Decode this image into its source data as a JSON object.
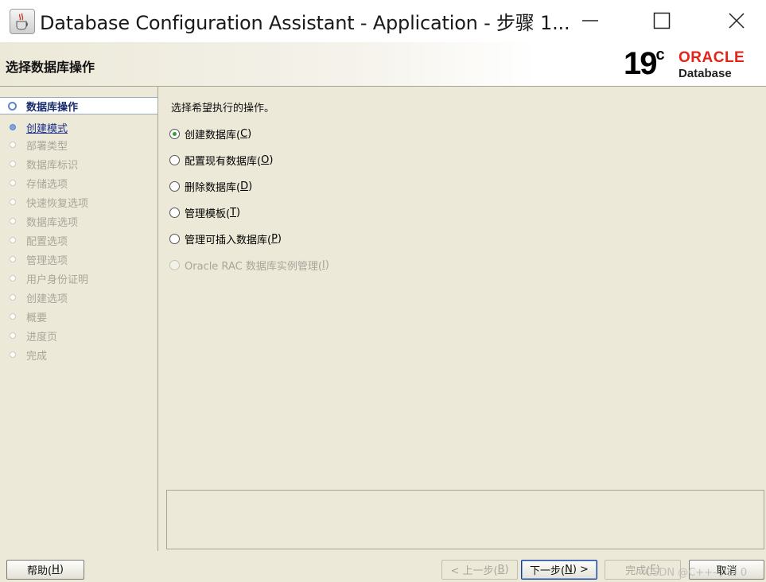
{
  "window": {
    "title": "Database Configuration Assistant - Application - 步骤 1...",
    "icon": "java-cup-icon"
  },
  "header": {
    "title": "选择数据库操作",
    "logo_version": "19",
    "logo_version_sup": "c",
    "logo_brand": "ORACLE",
    "logo_product": "Database",
    "brand_color": "#e3241b"
  },
  "steps": [
    {
      "label": "数据库操作",
      "state": "active"
    },
    {
      "label": "创建模式",
      "state": "link"
    },
    {
      "label": "部署类型",
      "state": "disabled"
    },
    {
      "label": "数据库标识",
      "state": "disabled"
    },
    {
      "label": "存储选项",
      "state": "disabled"
    },
    {
      "label": "快速恢复选项",
      "state": "disabled"
    },
    {
      "label": "数据库选项",
      "state": "disabled"
    },
    {
      "label": "配置选项",
      "state": "disabled"
    },
    {
      "label": "管理选项",
      "state": "disabled"
    },
    {
      "label": "用户身份证明",
      "state": "disabled"
    },
    {
      "label": "创建选项",
      "state": "disabled"
    },
    {
      "label": "概要",
      "state": "disabled"
    },
    {
      "label": "进度页",
      "state": "disabled"
    },
    {
      "label": "完成",
      "state": "disabled"
    }
  ],
  "main": {
    "prompt": "选择希望执行的操作。",
    "options": [
      {
        "label": "创建数据库(",
        "key": "C",
        "suffix": ")",
        "checked": true,
        "disabled": false
      },
      {
        "label": "配置现有数据库(",
        "key": "O",
        "suffix": ")",
        "checked": false,
        "disabled": false
      },
      {
        "label": "删除数据库(",
        "key": "D",
        "suffix": ")",
        "checked": false,
        "disabled": false
      },
      {
        "label": "管理模板(",
        "key": "T",
        "suffix": ")",
        "checked": false,
        "disabled": false
      },
      {
        "label": "管理可插入数据库(",
        "key": "P",
        "suffix": ")",
        "checked": false,
        "disabled": false
      },
      {
        "label": "Oracle RAC 数据库实例管理(",
        "key": "I",
        "suffix": ")",
        "checked": false,
        "disabled": true
      }
    ]
  },
  "footer": {
    "help": {
      "label": "帮助(",
      "key": "H",
      "suffix": ")"
    },
    "back": {
      "label": "< 上一步(",
      "key": "B",
      "suffix": ")"
    },
    "next": {
      "label": "下一步(",
      "key": "N",
      "suffix": ") >"
    },
    "finish": {
      "label": "完成(",
      "key": "F",
      "suffix": ")"
    },
    "cancel": {
      "label": "取消"
    },
    "watermark": "CSDN @C++-小白 0"
  }
}
